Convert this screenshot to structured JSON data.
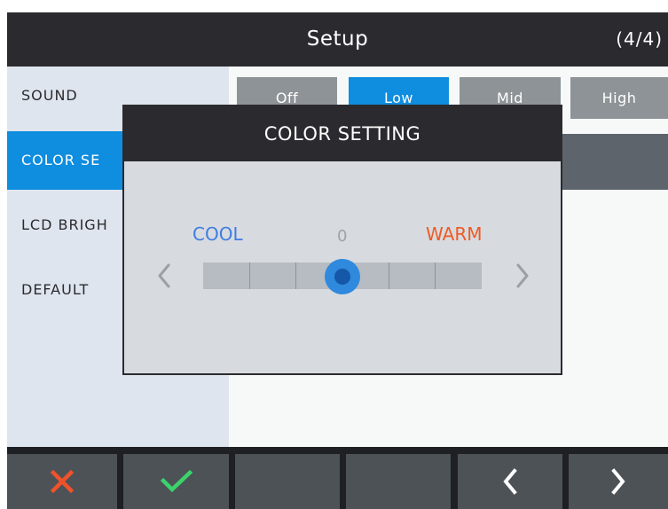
{
  "header": {
    "title": "Setup",
    "page_indicator": "(4/4)"
  },
  "sidebar": {
    "items": [
      {
        "label": "SOUND"
      },
      {
        "label": "COLOR SE"
      },
      {
        "label": "LCD BRIGH"
      },
      {
        "label": "DEFAULT"
      }
    ],
    "active_index": 1
  },
  "sound_options": [
    {
      "label": "Off"
    },
    {
      "label": "Low"
    },
    {
      "label": "Mid"
    },
    {
      "label": "High"
    }
  ],
  "sound_selected": "Low",
  "dialog": {
    "title": "COLOR SETTING",
    "left_label": "COOL",
    "right_label": "WARM",
    "value": "0",
    "slider_level": 0.5
  },
  "bottom_bar": {
    "buttons": [
      {
        "icon": "close-icon"
      },
      {
        "icon": "check-icon"
      },
      {
        "icon": ""
      },
      {
        "icon": ""
      },
      {
        "icon": "chevron-left-icon"
      },
      {
        "icon": "chevron-right-icon"
      }
    ]
  },
  "colors": {
    "accent": "#0f8ddf",
    "cool": "#3f7de0",
    "warm": "#ef5a22",
    "cancel": "#f0522a",
    "confirm": "#3bd36a"
  }
}
